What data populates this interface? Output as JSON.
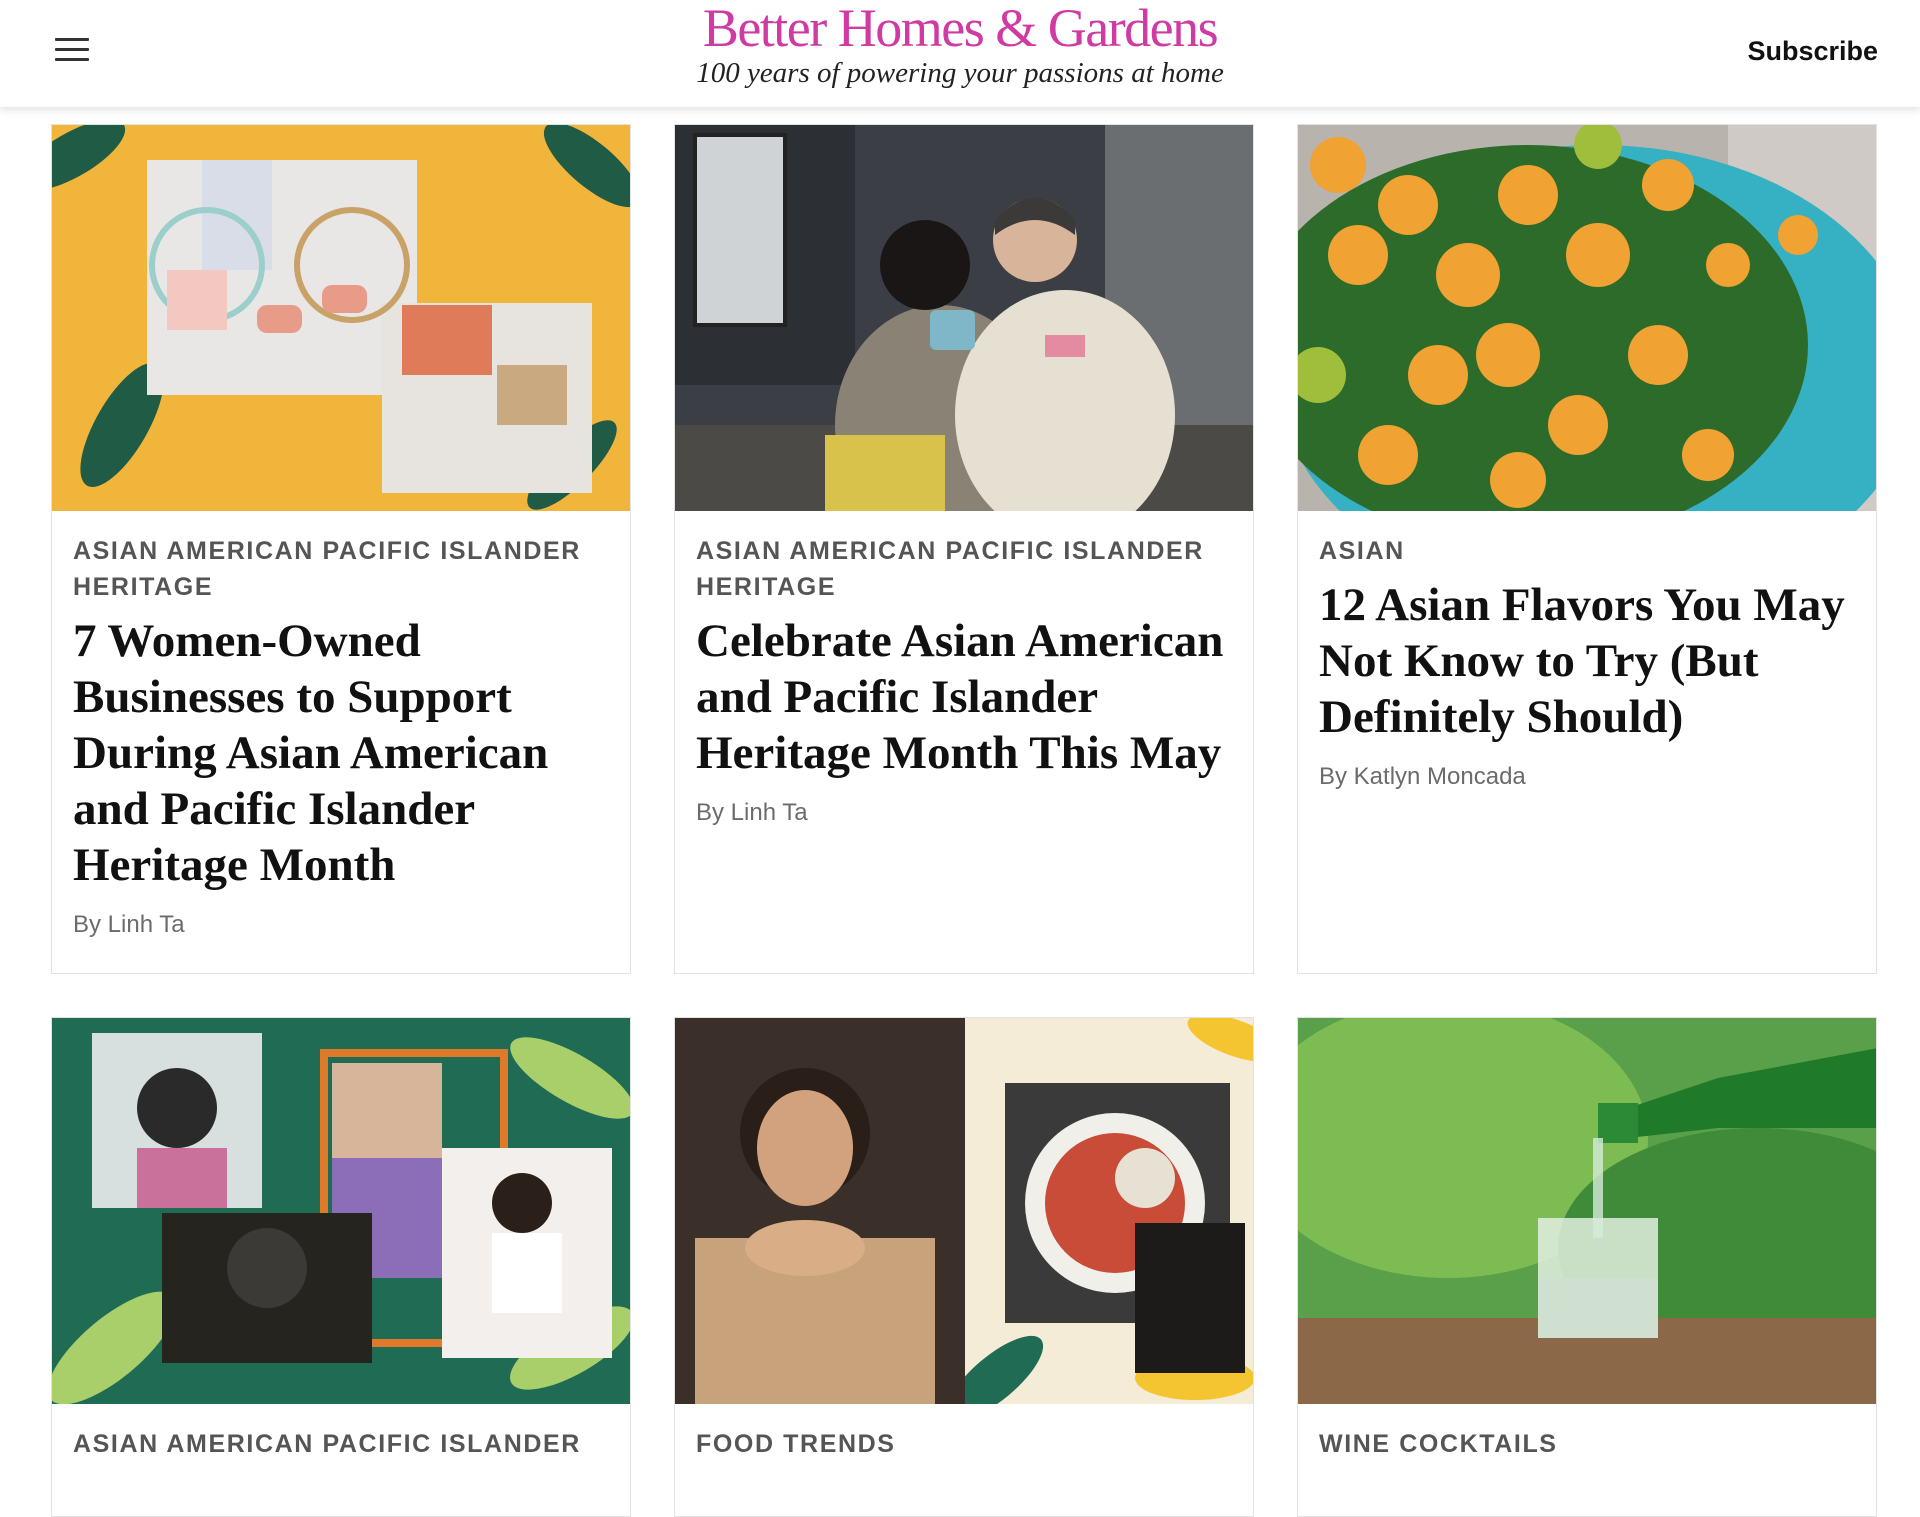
{
  "header": {
    "menu_icon": "hamburger-menu-icon",
    "brand": "Better Homes & Gardens",
    "tagline": "100 years of powering your passions at home",
    "subscribe_label": "Subscribe",
    "brand_color": "#cf3aa3"
  },
  "cards": [
    {
      "tag": "ASIAN AMERICAN PACIFIC ISLANDER HERITAGE",
      "title": "7 Women-Owned Businesses to Support During Asian American and Pacific Islander Heritage Month",
      "byline": "By Linh Ta"
    },
    {
      "tag": "ASIAN AMERICAN PACIFIC ISLANDER HERITAGE",
      "title": "Celebrate Asian American and Pacific Islander Heritage Month This May",
      "byline": "By Linh Ta"
    },
    {
      "tag": "ASIAN",
      "title": "12 Asian Flavors You May Not Know to Try (But Definitely Should)",
      "byline": "By Katlyn Moncada"
    },
    {
      "tag": "ASIAN AMERICAN PACIFIC ISLANDER"
    },
    {
      "tag": "FOOD TRENDS"
    },
    {
      "tag": "WINE COCKTAILS"
    }
  ]
}
